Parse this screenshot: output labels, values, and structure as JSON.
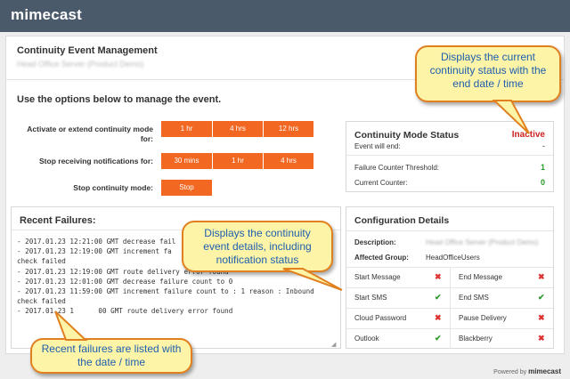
{
  "app": {
    "logo": "mimecast"
  },
  "header": {
    "title": "Continuity Event Management",
    "subtitle": "Head Office Server (Product Demo)"
  },
  "intro": "Use the options below to manage the event.",
  "options": {
    "activate_label_line1": "Activate or extend continuity mode",
    "activate_label_line2": "for:",
    "activate_buttons": [
      "1 hr",
      "4 hrs",
      "12 hrs"
    ],
    "notifications_label": "Stop receiving notifications for:",
    "notification_buttons": [
      "30 mins",
      "1 hr",
      "4 hrs"
    ],
    "stop_label": "Stop continuity mode:",
    "stop_button": "Stop"
  },
  "status": {
    "title": "Continuity Mode Status",
    "state": "Inactive",
    "event_will_end_label": "Event will end:",
    "event_will_end_value": "-",
    "failure_threshold_label": "Failure Counter Threshold:",
    "failure_threshold_value": "1",
    "current_counter_label": "Current Counter:",
    "current_counter_value": "0"
  },
  "failures": {
    "title": "Recent Failures:",
    "log": "- 2017.01.23 12:21:00 GMT decrease fail\n- 2017.01.23 12:19:00 GMT increment fa\ncheck failed\n- 2017.01.23 12:19:00 GMT route delivery error found\n- 2017.01.23 12:01:00 GMT decrease failure count to 0\n- 2017.01.23 11:59:00 GMT increment failure count to : 1 reason : Inbound\ncheck failed\n- 2017.01.23 1      00 GMT route delivery error found"
  },
  "config": {
    "title": "Configuration Details",
    "description_label": "Description:",
    "description_value": "Head Office Server (Product Demo)",
    "group_label": "Affected Group:",
    "group_value": "HeadOfficeUsers",
    "notifications": [
      {
        "left": "Start Message",
        "left_on": false,
        "right": "End Message",
        "right_on": false
      },
      {
        "left": "Start SMS",
        "left_on": true,
        "right": "End SMS",
        "right_on": true
      },
      {
        "left": "Cloud Password",
        "left_on": false,
        "right": "Pause Delivery",
        "right_on": false
      },
      {
        "left": "Outlook",
        "left_on": true,
        "right": "Blackberry",
        "right_on": false
      }
    ]
  },
  "callouts": {
    "status": "Displays the current continuity status with the end date / time",
    "details": "Displays the continuity event details, including notification status",
    "failures": "Recent failures are listed with the date / time"
  },
  "footer": {
    "powered_by": "Powered by",
    "brand": "mimecast"
  },
  "colors": {
    "accent": "#f26722",
    "topbar": "#4a5a6a",
    "inactive": "#cc2222",
    "ok": "#2a9a2a",
    "callout_text": "#1d5fae"
  }
}
